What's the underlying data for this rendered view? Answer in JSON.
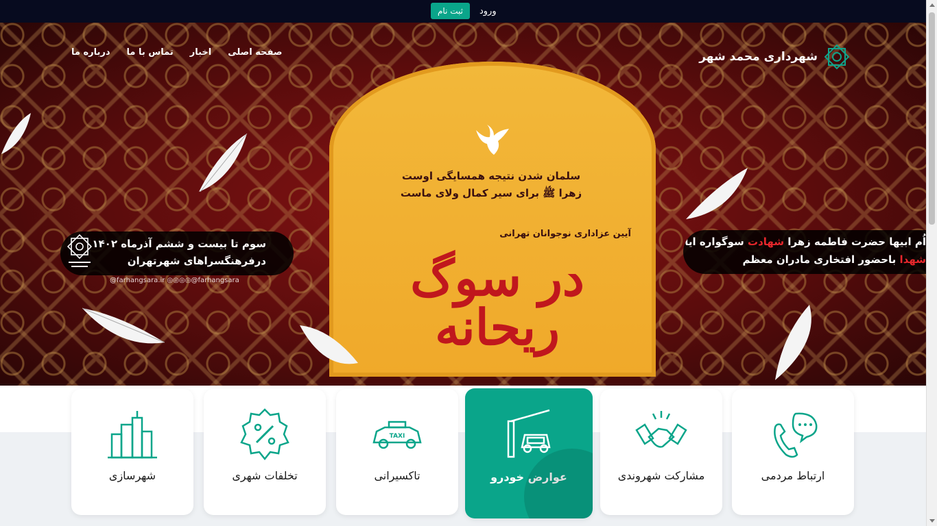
{
  "topbar": {
    "register_label": "ثبت نام",
    "login_label": "ورود"
  },
  "brand": {
    "name": "شهرداری محمد شهر",
    "logo_icon": "municipality-star-logo-icon"
  },
  "nav": {
    "items": [
      {
        "label": "صفحه اصلی"
      },
      {
        "label": "اخبار"
      },
      {
        "label": "تماس با ما"
      },
      {
        "label": "درباره ما"
      }
    ]
  },
  "hero": {
    "arch_line1": "سلمان شدن نتیجه همسایگی اوست",
    "arch_line2": "زهرا ﷺ برای سیر کمال ولای ماست",
    "subtitle": "آیین عزاداری    نوجوانان تهرانی",
    "title": "در سوگ ریحانه",
    "left_banner": {
      "line1": "سوم تا بیست و ششم آذرماه ۱۴۰۲",
      "line2": "درفرهنگسراهای شهرتهران",
      "social": "@farhangsara.ir  ◎◎◎◎@farhangsara"
    },
    "right_banner": {
      "line1_pre": "سوگواره ایام",
      "line1_red": "شهادت",
      "line1_post": "اُم ابیها حضرت فاطمه زهرا",
      "line2_pre": "باحضور افتخاری مادران معظم",
      "line2_red": "شهدا"
    }
  },
  "services": [
    {
      "label": "شهرسازی",
      "icon": "city-buildings-icon"
    },
    {
      "label": "تخلفات شهری",
      "icon": "percent-badge-icon"
    },
    {
      "label": "تاکسیرانی",
      "icon": "taxi-icon"
    },
    {
      "label": "عوارض خودرو",
      "icon": "car-toll-gate-icon",
      "active": true
    },
    {
      "label": "مشارکت شهروندی",
      "icon": "handshake-icon"
    },
    {
      "label": "ارتباط مردمی",
      "icon": "phone-chat-icon"
    }
  ],
  "colors": {
    "accent": "#0aa58a",
    "topbar": "#070b1f",
    "hero_red": "#8a1414",
    "arch_yellow": "#f2b83a",
    "title_red": "#c0171d"
  }
}
